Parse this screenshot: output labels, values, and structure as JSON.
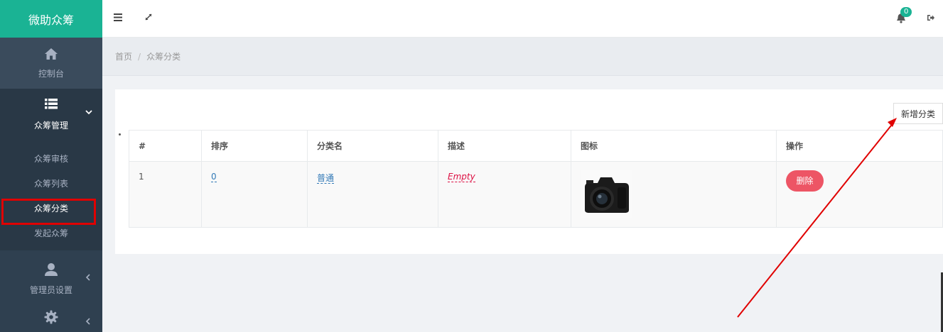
{
  "brand": "微助众筹",
  "sidebar": {
    "home": {
      "label": "控制台",
      "icon": "home-icon"
    },
    "crowdfund_group": {
      "label": "众筹管理",
      "icon": "list-icon",
      "items": [
        {
          "label": "众筹审核"
        },
        {
          "label": "众筹列表"
        },
        {
          "label": "众筹分类",
          "active": true
        },
        {
          "label": "发起众筹"
        }
      ]
    },
    "admin": {
      "label": "管理员设置",
      "icon": "user-icon"
    },
    "settings": {
      "icon": "gear-icon"
    }
  },
  "topbar": {
    "notification_count": "0"
  },
  "breadcrumb": {
    "home": "首页",
    "separator": "/",
    "current": "众筹分类"
  },
  "toolbar": {
    "add_label": "新增分类"
  },
  "table": {
    "columns": [
      "#",
      "排序",
      "分类名",
      "描述",
      "图标",
      "操作"
    ],
    "rows": [
      {
        "id": "1",
        "sort": "0",
        "name": "普通",
        "description": "Empty",
        "icon": "camera-image",
        "action": "删除"
      }
    ]
  },
  "colors": {
    "sidebar": "#2f4050",
    "brand": "#1ab394",
    "danger": "#ed5565",
    "highlight": "#e00000"
  }
}
